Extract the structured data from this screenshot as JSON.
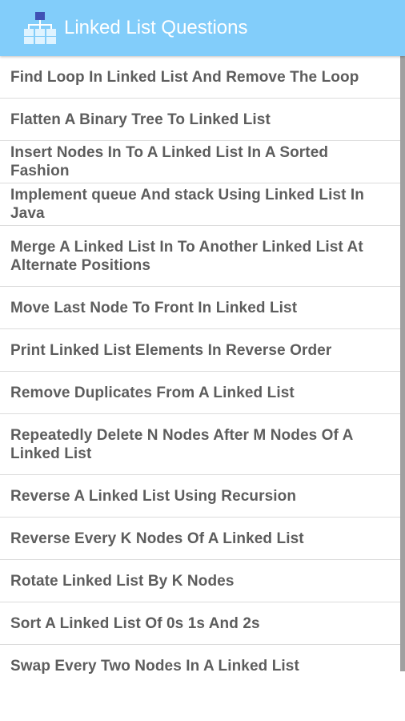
{
  "appbar": {
    "title": "Linked List Questions",
    "icon": "hierarchy-icon",
    "background_color": "#82cdfa"
  },
  "list": {
    "items": [
      {
        "label": "Find Loop In Linked List And Remove The Loop"
      },
      {
        "label": "Flatten A Binary Tree To Linked List"
      },
      {
        "label": "Insert Nodes In To A Linked List In A Sorted Fashion"
      },
      {
        "label": "Implement queue And stack Using Linked List In Java"
      },
      {
        "label": "Merge A Linked List In To Another Linked List At Alternate Positions"
      },
      {
        "label": "Move Last Node To Front In Linked List"
      },
      {
        "label": "Print Linked List Elements In Reverse Order"
      },
      {
        "label": "Remove Duplicates From A Linked List"
      },
      {
        "label": "Repeatedly Delete N Nodes After M Nodes Of A Linked List"
      },
      {
        "label": "Reverse A Linked List Using Recursion"
      },
      {
        "label": "Reverse Every K Nodes Of A Linked List"
      },
      {
        "label": "Rotate Linked List By K Nodes"
      },
      {
        "label": "Sort A Linked List Of 0s 1s And 2s"
      },
      {
        "label": "Swap Every Two Nodes In A Linked List"
      }
    ]
  }
}
